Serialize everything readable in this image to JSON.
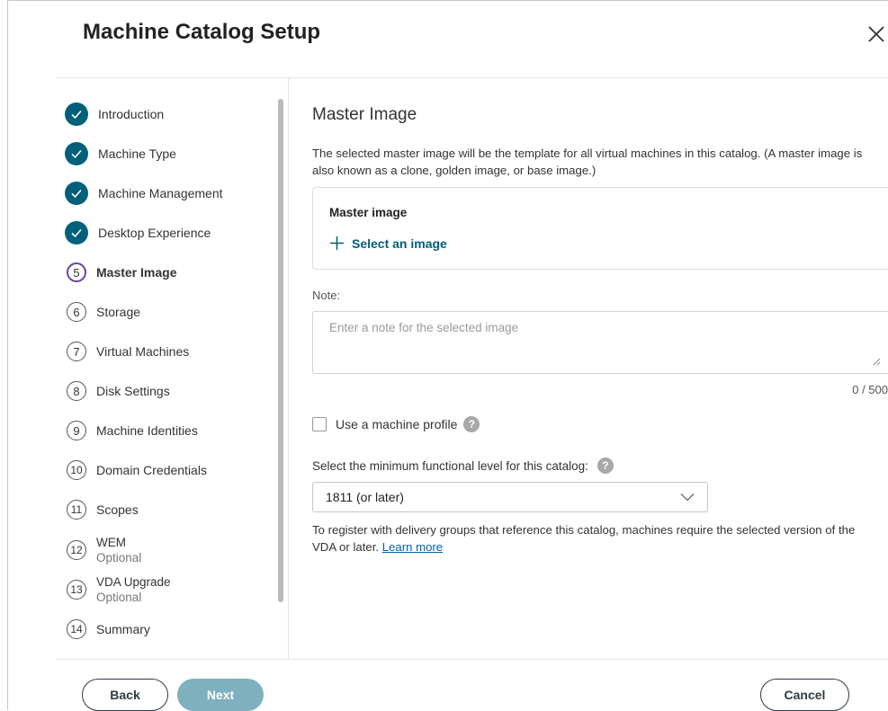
{
  "dialog": {
    "title": "Machine Catalog Setup",
    "close_icon": "close-icon"
  },
  "steps": [
    {
      "label": "Introduction",
      "status": "completed"
    },
    {
      "label": "Machine Type",
      "status": "completed"
    },
    {
      "label": "Machine Management",
      "status": "completed"
    },
    {
      "label": "Desktop Experience",
      "status": "completed"
    },
    {
      "number": "5",
      "label": "Master Image",
      "status": "current"
    },
    {
      "number": "6",
      "label": "Storage",
      "status": "pending"
    },
    {
      "number": "7",
      "label": "Virtual Machines",
      "status": "pending"
    },
    {
      "number": "8",
      "label": "Disk Settings",
      "status": "pending"
    },
    {
      "number": "9",
      "label": "Machine Identities",
      "status": "pending"
    },
    {
      "number": "10",
      "label": "Domain Credentials",
      "status": "pending"
    },
    {
      "number": "11",
      "label": "Scopes",
      "status": "pending"
    },
    {
      "number": "12",
      "label": "WEM",
      "sublabel": "Optional",
      "status": "pending"
    },
    {
      "number": "13",
      "label": "VDA Upgrade",
      "sublabel": "Optional",
      "status": "pending"
    },
    {
      "number": "14",
      "label": "Summary",
      "status": "pending"
    }
  ],
  "main": {
    "section_title": "Master Image",
    "description_line1": "The selected master image will be the template for all virtual machines in this catalog. (A master image is",
    "description_line2": "also known as a clone, golden image, or base image.)",
    "master_image_label": "Master image",
    "select_image_label": "Select an image",
    "note_label": "Note:",
    "note_placeholder": "Enter a note for the selected image",
    "note_value": "",
    "note_counter": "0 / 500",
    "machine_profile_label": "Use a machine profile",
    "machine_profile_checked": false,
    "help_glyph": "?",
    "functional_level_label": "Select the minimum functional level for this catalog:",
    "functional_level_value": "1811 (or later)",
    "register_text_line1": "To register with delivery groups that reference this catalog, machines require the selected version of the",
    "register_text_line2_prefix": "VDA or later. ",
    "learn_more_label": "Learn more"
  },
  "footer": {
    "back_label": "Back",
    "next_label": "Next",
    "cancel_label": "Cancel"
  },
  "colors": {
    "accent": "#00607a",
    "current_step_ring": "#6b3fa8",
    "next_disabled": "#7fb0be",
    "link": "#0063a6"
  }
}
